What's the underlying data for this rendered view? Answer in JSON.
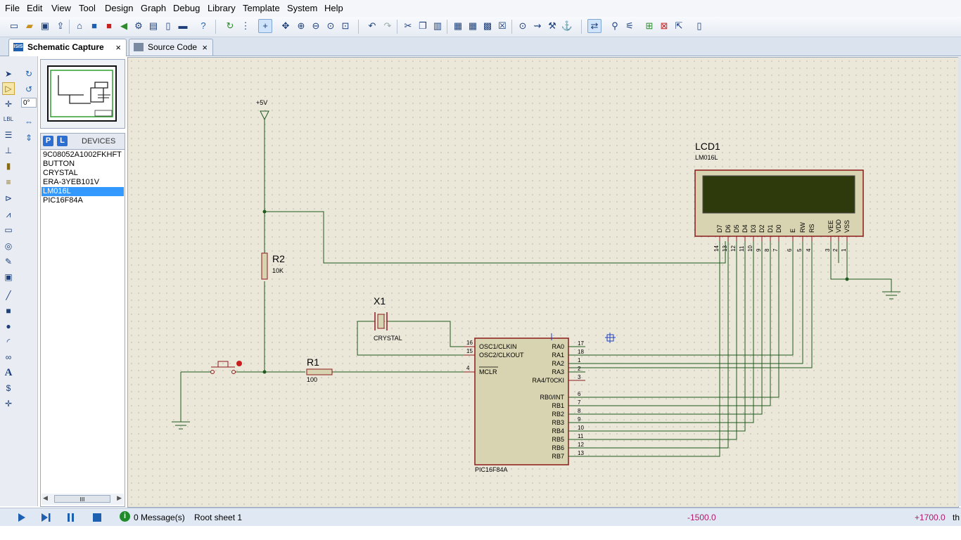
{
  "menu": [
    "File",
    "Edit",
    "View",
    "Tool",
    "Design",
    "Graph",
    "Debug",
    "Library",
    "Template",
    "System",
    "Help"
  ],
  "tabs": [
    {
      "icon": "ISIS",
      "label": "Schematic Capture",
      "close": "×"
    },
    {
      "icon": "",
      "label": "Source Code",
      "close": "×"
    }
  ],
  "left_tools": {
    "angle": "0°"
  },
  "devices": {
    "pick_button": "P",
    "library_button": "L",
    "title": "DEVICES",
    "items": [
      "9C08052A1002FKHFT",
      "BUTTON",
      "CRYSTAL",
      "ERA-3YEB101V",
      "LM016L",
      "PIC16F84A"
    ],
    "selected_index": 4,
    "scroll_grip": "III"
  },
  "schematic": {
    "power_label": "+5V",
    "r2": {
      "ref": "R2",
      "value": "10K"
    },
    "r1": {
      "ref": "R1",
      "value": "100"
    },
    "x1": {
      "ref": "X1",
      "value": "CRYSTAL"
    },
    "lcd": {
      "ref": "LCD1",
      "value": "LM016L",
      "pins": [
        {
          "name": "VSS",
          "num": "1"
        },
        {
          "name": "VDD",
          "num": "2"
        },
        {
          "name": "VEE",
          "num": "3"
        },
        {
          "name": "RS",
          "num": "4"
        },
        {
          "name": "RW",
          "num": "5"
        },
        {
          "name": "E",
          "num": "6"
        },
        {
          "name": "D0",
          "num": "7"
        },
        {
          "name": "D1",
          "num": "8"
        },
        {
          "name": "D2",
          "num": "9"
        },
        {
          "name": "D3",
          "num": "10"
        },
        {
          "name": "D4",
          "num": "11"
        },
        {
          "name": "D5",
          "num": "12"
        },
        {
          "name": "D6",
          "num": "13"
        },
        {
          "name": "D7",
          "num": "14"
        }
      ]
    },
    "mcu": {
      "ref": "PIC16F84A",
      "left_pins": [
        {
          "name": "OSC1/CLKIN",
          "num": "16"
        },
        {
          "name": "OSC2/CLKOUT",
          "num": "15"
        },
        {
          "name": "MCLR",
          "num": "4"
        }
      ],
      "right_pins": [
        {
          "name": "RA0",
          "num": "17"
        },
        {
          "name": "RA1",
          "num": "18"
        },
        {
          "name": "RA2",
          "num": "1"
        },
        {
          "name": "RA3",
          "num": "2"
        },
        {
          "name": "RA4/T0CKI",
          "num": "3"
        },
        {
          "name": "RB0/INT",
          "num": "6"
        },
        {
          "name": "RB1",
          "num": "7"
        },
        {
          "name": "RB2",
          "num": "8"
        },
        {
          "name": "RB3",
          "num": "9"
        },
        {
          "name": "RB4",
          "num": "10"
        },
        {
          "name": "RB5",
          "num": "11"
        },
        {
          "name": "RB6",
          "num": "12"
        },
        {
          "name": "RB7",
          "num": "13"
        }
      ]
    }
  },
  "status": {
    "messages": "0 Message(s)",
    "sheet": "Root sheet 1",
    "coord_x": "-1500.0",
    "coord_y": "+1700.0",
    "units": "th"
  },
  "colors": {
    "wire": "#1f5a1f",
    "component": "#8b1a1a",
    "canvas": "#ebe8da",
    "lcd_screen": "#2e3a0c"
  }
}
